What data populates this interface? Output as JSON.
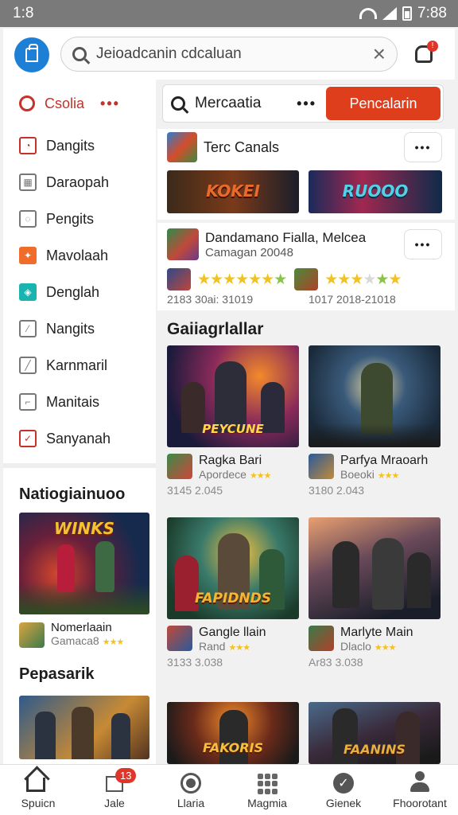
{
  "status_bar": {
    "time": "1:8",
    "clock": "7:88"
  },
  "header": {
    "search_text": "Jeioadcanin cdcaluan",
    "clear_symbol": "×",
    "bell_badge": "!"
  },
  "sidebar": {
    "items": [
      {
        "label": "Csolia",
        "icon": "search-icon"
      },
      {
        "label": "Dangits",
        "icon": "clock-icon"
      },
      {
        "label": "Daraopah",
        "icon": "grid-icon"
      },
      {
        "label": "Pengits",
        "icon": "tag-icon"
      },
      {
        "label": "Mavolaah",
        "icon": "star-icon"
      },
      {
        "label": "Denglah",
        "icon": "tag-icon"
      },
      {
        "label": "Nangits",
        "icon": "pen-icon"
      },
      {
        "label": "Karnmaril",
        "icon": "edit-icon"
      },
      {
        "label": "Manitais",
        "icon": "folder-icon"
      },
      {
        "label": "Sanyanah",
        "icon": "check-icon"
      }
    ],
    "more_dots": "•••",
    "section1_title": "Natiogiainuoo",
    "section1_banner_text": "WINKS",
    "section1_app_title": "Nomerlaain",
    "section1_app_sub": "Gamaca8",
    "section2_title": "Pepasarik"
  },
  "main": {
    "search_text": "Mercaatia",
    "search_dots": "•••",
    "search_button": "Pencalarin",
    "card1": {
      "title": "Terc Canals",
      "more": "•••",
      "banner1_text": "KOKEI",
      "banner2_text": "RUOOO"
    },
    "card2": {
      "title": "Dandamano Fialla, Melcea",
      "subtitle": "Camagan 20048",
      "more": "•••",
      "meta1": "2183 30ai: 31019",
      "meta2": "1017  2018-21018"
    },
    "section_title": "Gaiiagrlallar",
    "games": [
      {
        "title": "Ragka Bari",
        "sub": "Apordece",
        "meta": "3145  2.045",
        "art": "PEYCUNE"
      },
      {
        "title": "Parfya Mraoarh",
        "sub": "Boeoki",
        "meta": "3180  2.043",
        "art": ""
      },
      {
        "title": "Gangle llain",
        "sub": "Rand",
        "meta": "3133  3.038",
        "art": "FAPIDNDS"
      },
      {
        "title": "Marlyte Main",
        "sub": "Dlaclo",
        "meta": "Ar83  3.038",
        "art": ""
      },
      {
        "title": "",
        "sub": "",
        "meta": "",
        "art": "FAKORIS"
      },
      {
        "title": "",
        "sub": "",
        "meta": "",
        "art": "FAANINS"
      }
    ]
  },
  "bottom_nav": [
    {
      "label": "Spuicn",
      "icon": "home-icon"
    },
    {
      "label": "Jale",
      "icon": "inbox-icon",
      "badge": "13"
    },
    {
      "label": "Llaria",
      "icon": "record-icon"
    },
    {
      "label": "Magmia",
      "icon": "apps-icon"
    },
    {
      "label": "Gienek",
      "icon": "shield-icon"
    },
    {
      "label": "Fhoorotant",
      "icon": "profile-icon"
    }
  ],
  "colors": {
    "accent": "#de3e1c",
    "brand": "#1e7fd6",
    "star": "#f3c221"
  }
}
